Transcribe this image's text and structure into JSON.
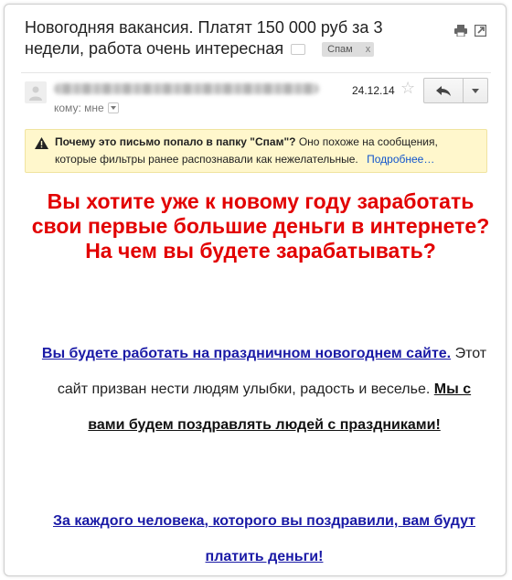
{
  "email": {
    "subject": "Новогодняя вакансия. Платят 150 000 руб за 3 недели, работа очень интересная",
    "label": "Спам",
    "label_close": "x",
    "recipient_label": "кому: мне",
    "date": "24.12.14"
  },
  "icons": {
    "print": "print-icon",
    "new_window": "new-window-icon",
    "avatar": "avatar-icon",
    "star": "star-icon",
    "reply": "reply-icon",
    "more": "chevron-down-icon",
    "warning": "warning-icon"
  },
  "spam_notice": {
    "question": "Почему это письмо попало в папку \"Спам\"?",
    "explanation": "Оно похоже на сообщения, которые фильтры ранее распознавали как нежелательные.",
    "more_link": "Подробнее…"
  },
  "body": {
    "headline_1": "Вы хотите уже к новому году заработать свои первые большие деньги в интернете?",
    "headline_2": "На чем вы будете зарабатывать?",
    "p1_link": "Вы будете работать на праздничном новогоднем сайте.",
    "p1_text": " Этот сайт призван нести людям улыбки, радость и веселье. ",
    "p1_bold": "Мы с вами будем поздравлять людей с праздниками!",
    "p2_link": "За каждого человека, которого вы поздравили, вам будут платить деньги!"
  },
  "colors": {
    "headline": "#e20000",
    "link": "#1a1aa6",
    "warning_bg": "#fff7cc"
  }
}
